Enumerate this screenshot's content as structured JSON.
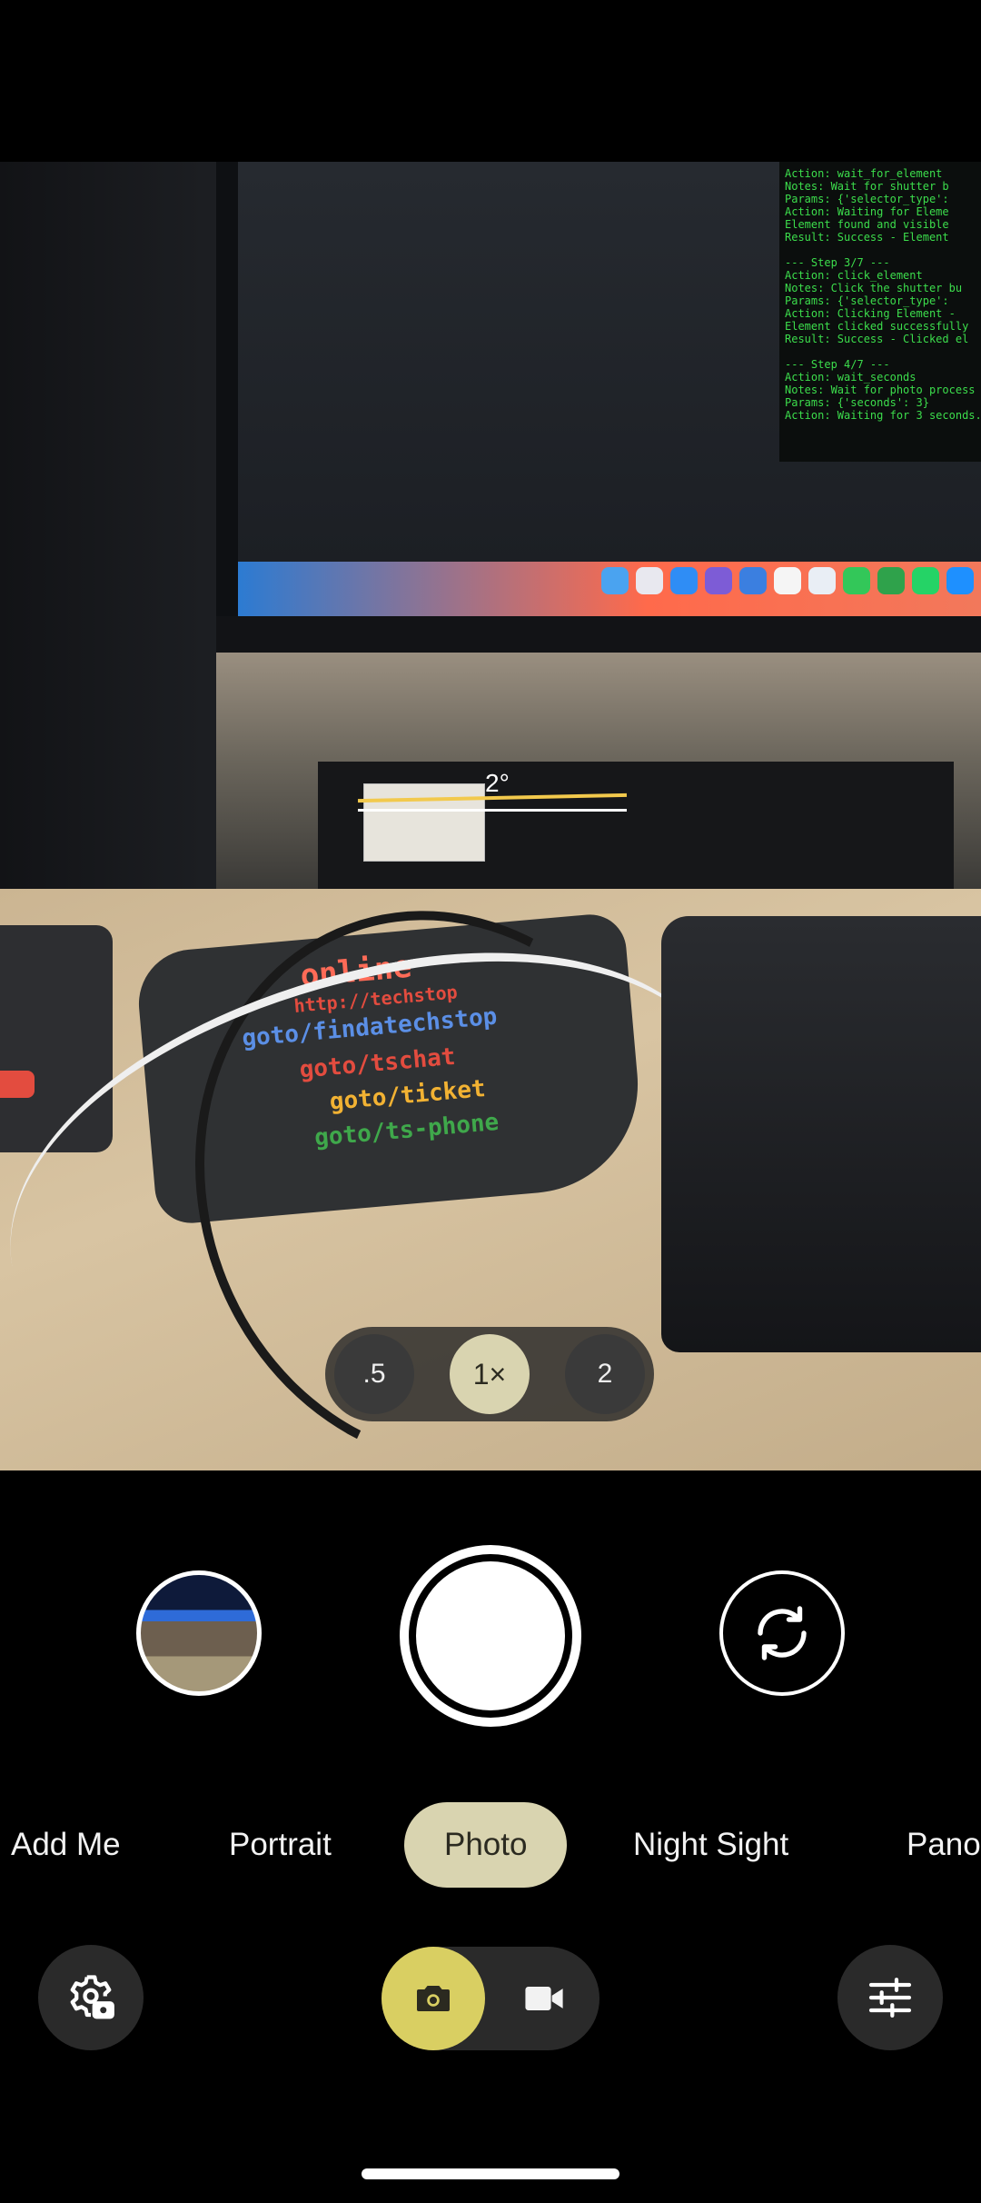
{
  "viewfinder": {
    "level_angle": "2°",
    "terminal_lines": [
      "Action: wait_for_element",
      "Notes: Wait for shutter b",
      "Params: {'selector_type':",
      "Action: Waiting for Eleme",
      "Element found and visible",
      "Result: Success - Element",
      "",
      "--- Step 3/7 ---",
      "Action: click_element",
      "Notes: Click the shutter bu",
      "Params: {'selector_type':",
      "Action: Clicking Element -",
      "Element clicked successfully",
      "Result: Success - Clicked el",
      "",
      "--- Step 4/7 ---",
      "Action: wait_seconds",
      "Notes: Wait for photo process",
      "Params: {'seconds': 3}",
      "Action: Waiting for 3 seconds."
    ],
    "mat_lines": [
      "online",
      "http://techstop",
      "goto/findatechstop",
      "goto/tschat",
      "goto/ticket",
      "goto/ts-phone"
    ]
  },
  "zoom": {
    "options": [
      ".5",
      "1×",
      "2"
    ],
    "selected": "1×"
  },
  "modes": {
    "items": [
      "Add Me",
      "Portrait",
      "Photo",
      "Night Sight",
      "Pano"
    ],
    "selected": "Photo"
  },
  "colors": {
    "accent_pill": "#d9d4b0",
    "photo_toggle": "#d9cf62",
    "level_line": "#f2c94c",
    "terminal_text": "#3cdd4c"
  },
  "icons": {
    "settings": "settings-camera-icon",
    "photo": "camera-icon",
    "video": "video-camera-icon",
    "adjust": "sliders-icon",
    "flip": "flip-camera-icon"
  }
}
